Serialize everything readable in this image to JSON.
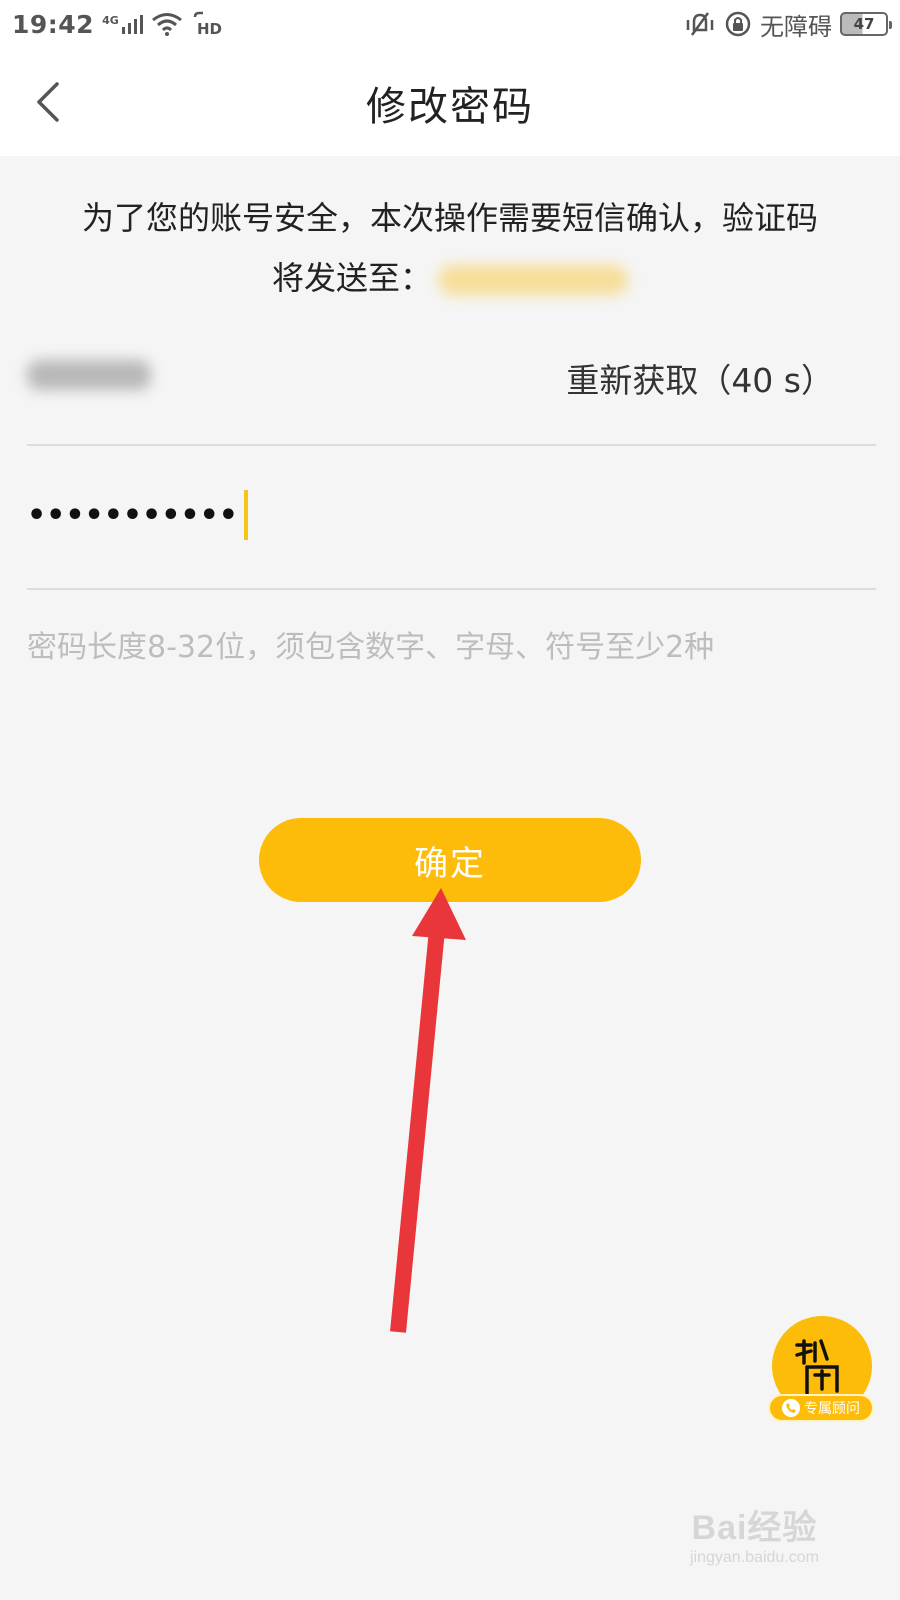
{
  "status_bar": {
    "time": "19:42",
    "network": "4G",
    "hd": "HD",
    "accessibility": "无障碍",
    "battery": "47"
  },
  "header": {
    "title": "修改密码"
  },
  "notice": {
    "line1": "为了您的账号安全，本次操作需要短信确认，验证码",
    "line2": "将发送至："
  },
  "verification": {
    "resend_label": "重新获取（40 s）"
  },
  "password": {
    "value": "•••••••••••"
  },
  "hint": "密码长度8-32位，须包含数字、字母、符号至少2种",
  "confirm_label": "确定",
  "advisor": {
    "label": "专属顾问"
  },
  "watermark": {
    "brand": "Bai经验",
    "url": "jingyan.baidu.com"
  },
  "colors": {
    "accent": "#fdbb0a",
    "annotation_arrow": "#e8363a",
    "background": "#f5f5f5"
  }
}
